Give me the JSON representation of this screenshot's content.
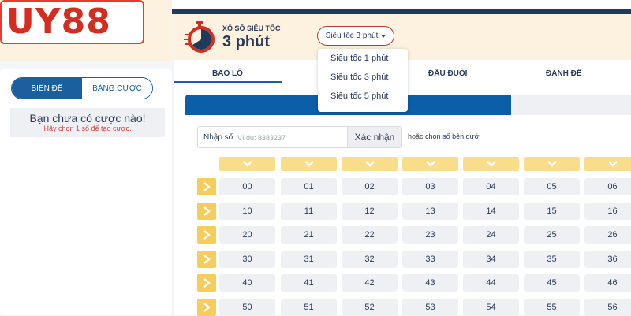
{
  "brand": {
    "logo_text": "UY88"
  },
  "sidebar": {
    "tabs": [
      {
        "label": "BIÊN ĐỀ",
        "active": true
      },
      {
        "label": "BẢNG CƯỢC",
        "active": false
      }
    ],
    "empty_title": "Bạn chưa có cược nào!",
    "empty_sub": "Hãy chọn 1 số để tạo cược."
  },
  "game": {
    "small_title": "XỔ SỐ SIÊU TỐC",
    "big_title": "3 phút",
    "icon": "stopwatch-icon"
  },
  "mode_select": {
    "value": "Siêu tốc 3 phút",
    "options": [
      "Siêu tốc 1 phút",
      "Siêu tốc 3 phút",
      "Siêu tốc 5 phút"
    ]
  },
  "nav": {
    "tabs": [
      "BAO LÔ",
      "ĐẦU ĐUÔI",
      "ĐÁNH ĐỀ"
    ]
  },
  "number_input": {
    "label": "Nhập số",
    "placeholder": "Ví dụ: 8383237",
    "confirm_label": "Xác nhận",
    "or_prefix": "hoặc",
    "or_text": "chọn số bên dưới"
  },
  "grid": {
    "rows": [
      [
        "00",
        "01",
        "02",
        "03",
        "04",
        "05",
        "06"
      ],
      [
        "10",
        "11",
        "12",
        "13",
        "14",
        "15",
        "16"
      ],
      [
        "20",
        "21",
        "22",
        "23",
        "24",
        "25",
        "26"
      ],
      [
        "30",
        "31",
        "32",
        "33",
        "34",
        "35",
        "36"
      ],
      [
        "40",
        "41",
        "42",
        "43",
        "44",
        "45",
        "46"
      ],
      [
        "50",
        "51",
        "52",
        "53",
        "54",
        "55",
        "56"
      ]
    ]
  },
  "colors": {
    "accent_blue": "#0b5ea8",
    "brand_red": "#d62b1f",
    "yellow": "#f6cd5c",
    "cream": "#fdf2df"
  }
}
